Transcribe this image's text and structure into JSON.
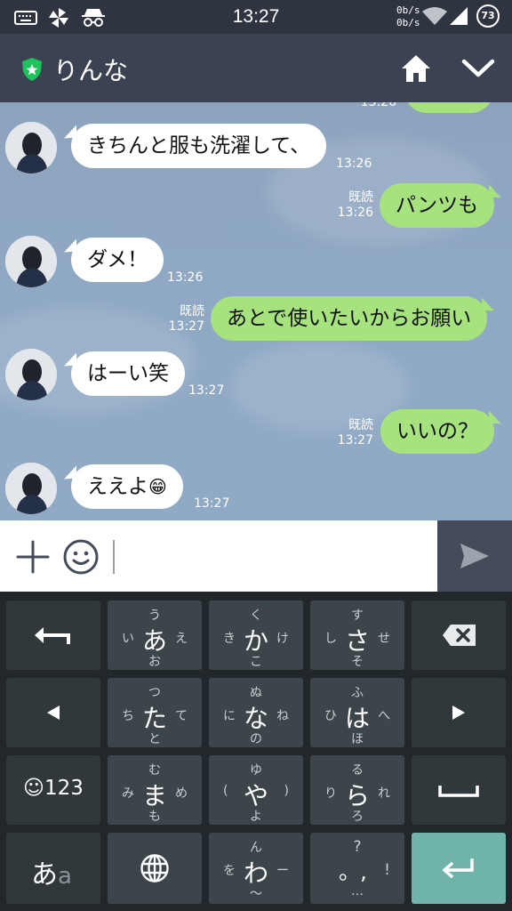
{
  "status_bar": {
    "time": "13:27",
    "net_up": "0b/s",
    "net_down": "0b/s",
    "battery": "73"
  },
  "header": {
    "title": "りんな"
  },
  "messages": [
    {
      "side": "in",
      "text": "きちんと服も洗濯して、",
      "time": "13:26"
    },
    {
      "side": "out",
      "text": "パンツも",
      "read": "既読",
      "time": "13:26"
    },
    {
      "side": "in",
      "text": "ダメ！",
      "time": "13:26"
    },
    {
      "side": "out",
      "text": "あとで使いたいからお願い",
      "read": "既読",
      "time": "13:27"
    },
    {
      "side": "in",
      "text": "はーい笑",
      "time": "13:27"
    },
    {
      "side": "out",
      "text": "いいの？",
      "read": "既読",
      "time": "13:27"
    },
    {
      "side": "in",
      "text": "ええよ",
      "emoji": "😁",
      "time": "13:27"
    }
  ],
  "partial_top": {
    "time": "13:26"
  },
  "keyboard": {
    "a_key": {
      "main": "あ",
      "top": "う",
      "left": "い",
      "right": "え",
      "bottom": "お"
    },
    "ka_key": {
      "main": "か",
      "top": "く",
      "left": "き",
      "right": "け",
      "bottom": "こ"
    },
    "sa_key": {
      "main": "さ",
      "top": "す",
      "left": "し",
      "right": "せ",
      "bottom": "そ"
    },
    "ta_key": {
      "main": "た",
      "top": "つ",
      "left": "ち",
      "right": "て",
      "bottom": "と"
    },
    "na_key": {
      "main": "な",
      "top": "ぬ",
      "left": "に",
      "right": "ね",
      "bottom": "の"
    },
    "ha_key": {
      "main": "は",
      "top": "ふ",
      "left": "ひ",
      "right": "へ",
      "bottom": "ほ"
    },
    "ma_key": {
      "main": "ま",
      "top": "む",
      "left": "み",
      "right": "め",
      "bottom": "も"
    },
    "ya_key": {
      "main": "や",
      "top": "ゆ",
      "left": "(",
      "right": ")",
      "bottom": "よ"
    },
    "ra_key": {
      "main": "ら",
      "top": "る",
      "left": "り",
      "right": "れ",
      "bottom": "ろ"
    },
    "wa_key": {
      "main": "わ",
      "top": "ん",
      "left": "を",
      "right": "ー",
      "bottom": "〜"
    },
    "punct_key": {
      "main": "。,",
      "top": "?",
      "right": "!",
      "bottom": "…"
    },
    "mode_key": "☺123",
    "lang_key_main": "あ",
    "lang_key_sub": "a"
  }
}
